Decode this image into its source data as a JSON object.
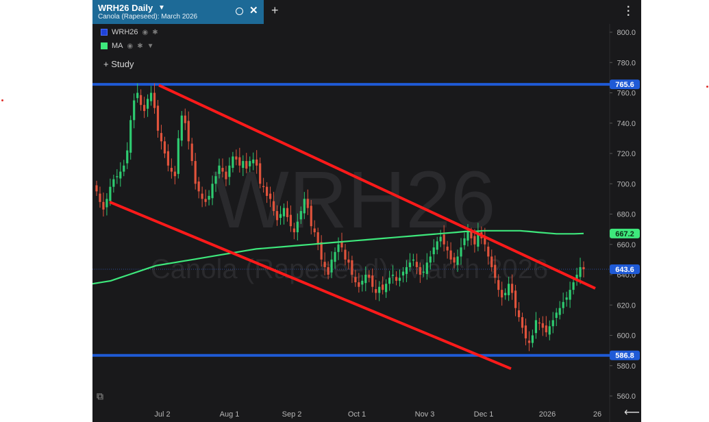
{
  "tab": {
    "symbol_title": "WRH26 Daily",
    "description": "Canola (Rapeseed): March 2026"
  },
  "legend": [
    {
      "label": "WRH26",
      "color": "#1f43d8"
    },
    {
      "label": "MA",
      "color": "#3ee87c"
    }
  ],
  "study_button": "Study",
  "watermark": {
    "symbol": "WRH26",
    "description": "Canola (Rapeseed): March 2026"
  },
  "colors": {
    "up": "#2ecc71",
    "down": "#e0533c",
    "blue_line": "#1f5ad6",
    "trend": "#ff1a1a",
    "ma": "#3ee87c",
    "background": "#19191b"
  },
  "icons": [
    "caret-down-icon",
    "circle-icon",
    "close-icon",
    "plus-icon",
    "more-vert-icon",
    "eye-icon",
    "gear-icon",
    "logo-icon",
    "arrow-left-icon"
  ],
  "chart_data": {
    "type": "candlestick",
    "y_ticks": [
      "800.0",
      "780.0",
      "760.0",
      "740.0",
      "720.0",
      "700.0",
      "680.0",
      "660.0",
      "640.0",
      "620.0",
      "600.0",
      "580.0",
      "560.0"
    ],
    "x_ticks": [
      "Jul 2",
      "Aug 1",
      "Sep 2",
      "Oct 1",
      "Nov 3",
      "Dec 1",
      "2026",
      "26"
    ],
    "ylim": [
      552,
      809
    ],
    "price_labels": [
      {
        "text": "765.6",
        "value": 765.6,
        "bg": "#1f5ad6",
        "fg": "#ffffff"
      },
      {
        "text": "667.2",
        "value": 667.2,
        "bg": "#3ee87c",
        "fg": "#0b2e17"
      },
      {
        "text": "643.6",
        "value": 643.6,
        "bg": "#1f5ad6",
        "fg": "#ffffff"
      },
      {
        "text": "586.8",
        "value": 586.8,
        "bg": "#1f5ad6",
        "fg": "#ffffff"
      }
    ],
    "horizontal_lines": [
      765.6,
      586.8
    ],
    "last_price": 643.6,
    "series": [
      {
        "name": "WRH26",
        "type": "candlestick",
        "close": [
          695,
          688,
          683,
          690,
          698,
          703,
          705,
          708,
          712,
          722,
          742,
          755,
          760,
          752,
          748,
          756,
          760,
          750,
          735,
          728,
          720,
          712,
          708,
          705,
          730,
          745,
          740,
          728,
          715,
          700,
          695,
          690,
          688,
          692,
          700,
          705,
          712,
          708,
          703,
          712,
          718,
          716,
          712,
          715,
          710,
          715,
          716,
          712,
          700,
          698,
          692,
          690,
          682,
          676,
          680,
          684,
          678,
          672,
          668,
          675,
          682,
          690,
          684,
          672,
          668,
          660,
          650,
          645,
          640,
          650,
          655,
          660,
          658,
          650,
          648,
          640,
          635,
          632,
          636,
          640,
          638,
          632,
          628,
          632,
          630,
          634,
          638,
          640,
          636,
          638,
          642,
          645,
          648,
          650,
          645,
          640,
          642,
          648,
          652,
          658,
          662,
          665,
          660,
          656,
          650,
          648,
          652,
          658,
          664,
          668,
          664,
          660,
          668,
          664,
          660,
          652,
          645,
          638,
          630,
          625,
          628,
          634,
          628,
          618,
          612,
          605,
          598,
          595,
          600,
          610,
          608,
          605,
          602,
          606,
          610,
          615,
          618,
          622,
          625,
          630,
          635,
          640,
          645,
          643.6
        ]
      },
      {
        "name": "MA",
        "type": "line",
        "values": [
          634,
          635,
          636,
          638,
          640,
          642,
          644,
          646,
          647,
          648,
          649,
          650,
          651,
          652,
          653,
          654,
          655,
          656,
          657,
          657.5,
          658,
          658.5,
          659,
          659.5,
          660,
          660.5,
          661,
          661.5,
          662,
          662.5,
          663,
          663.5,
          664,
          664.5,
          665,
          665.5,
          666,
          666.5,
          667,
          667.5,
          668,
          668.5,
          668.5,
          669,
          669,
          669,
          669,
          669,
          668.5,
          668,
          667.5,
          667,
          667,
          667,
          667.2
        ]
      }
    ],
    "trendlines": [
      {
        "from": [
          "Jul 1",
          765
        ],
        "to": [
          "Jan 30",
          631
        ]
      },
      {
        "from": [
          "Jun 12",
          688
        ],
        "to": [
          "Dec 28",
          578
        ]
      }
    ]
  }
}
